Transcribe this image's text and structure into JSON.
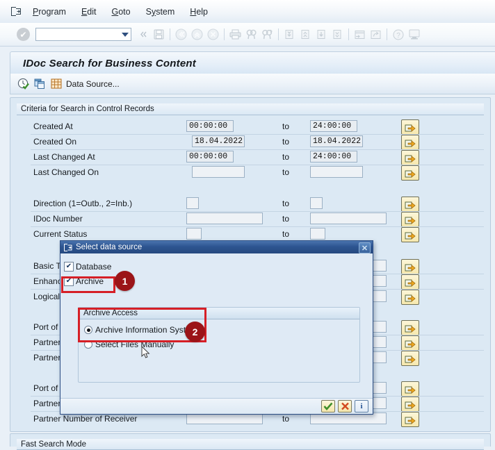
{
  "menu": {
    "sap_icon": "sap-exit-icon",
    "items": [
      {
        "label": "Program",
        "accel": "P"
      },
      {
        "label": "Edit",
        "accel": "E"
      },
      {
        "label": "Goto",
        "accel": "G"
      },
      {
        "label": "System",
        "accel": "y"
      },
      {
        "label": "Help",
        "accel": "H"
      }
    ]
  },
  "toolbar": {
    "enter_icon": "green-check-icon",
    "command_field_value": "",
    "command_field_placeholder": "",
    "icons": [
      "save-icon",
      "back-icon",
      "exit-up-icon",
      "cancel-icon",
      "print-icon",
      "find-icon",
      "find-next-icon",
      "first-page-icon",
      "previous-page-icon",
      "next-page-icon",
      "last-page-icon",
      "create-session-icon",
      "create-shortcut-icon",
      "help-icon",
      "customize-local-layout-icon"
    ]
  },
  "screen": {
    "title": "IDoc Search for Business Content"
  },
  "app_toolbar": {
    "execute_icon": "execute-clock-check-icon",
    "copy_icon": "copy-icon",
    "data_source_icon": "grid-table-icon",
    "data_source_label": "Data Source..."
  },
  "criteria": {
    "group_title": "Criteria for Search in Control Records",
    "to_label": "to",
    "multi_select_icon": "multiple-selection-arrow-icon",
    "rows": [
      {
        "label": "Created At",
        "from": "00:00:00",
        "to": "24:00:00",
        "width": "narrow"
      },
      {
        "label": "Created On",
        "from": "18.04.2022",
        "to": "18.04.2022",
        "width": "narrow"
      },
      {
        "label": "Last Changed At",
        "from": "00:00:00",
        "to": "24:00:00",
        "width": "narrow"
      },
      {
        "label": "Last Changed On",
        "from": "",
        "to": "",
        "width": "narrow"
      }
    ],
    "rows2": [
      {
        "label": "Direction (1=Outb., 2=Inb.)",
        "from": "",
        "to": "",
        "width": "tiny"
      },
      {
        "label": "IDoc Number",
        "from": "",
        "to": "",
        "width": "wide"
      },
      {
        "label": "Current Status",
        "from": "",
        "to": "",
        "width": "tiny"
      }
    ],
    "rows3": [
      {
        "label": "Basic Type",
        "from": "",
        "to": ""
      },
      {
        "label": "Enhancement",
        "from": "",
        "to": ""
      },
      {
        "label": "Logical Message",
        "from": "",
        "to": ""
      }
    ],
    "rows4": [
      {
        "label": "Port of Sender",
        "from": "",
        "to": ""
      },
      {
        "label": "Partner Type of Sender",
        "from": "",
        "to": ""
      },
      {
        "label": "Partner Number of Sender",
        "from": "",
        "to": ""
      }
    ],
    "rows5": [
      {
        "label": "Port of Receiver",
        "from": "",
        "to": ""
      },
      {
        "label": "Partner Type of Receiver",
        "from": "",
        "to": ""
      },
      {
        "label": "Partner Number of Receiver",
        "from": "",
        "to": ""
      }
    ]
  },
  "bottom_group": {
    "title": "Fast Search Mode"
  },
  "dialog": {
    "icon": "dialog-window-icon",
    "title": "Select data source",
    "close_label": "✕",
    "checkboxes": [
      {
        "label": "Database",
        "checked": true,
        "mark": "✔"
      },
      {
        "label": "Archive",
        "checked": true,
        "mark": "✔"
      }
    ],
    "subgroup_title": "Archive Access",
    "radios": [
      {
        "label": "Archive Information System",
        "selected": true
      },
      {
        "label": "Select Files Manually",
        "selected": false
      }
    ],
    "footer": {
      "confirm_icon": "green-check-icon",
      "cancel_icon": "red-x-icon",
      "info_icon": "blue-info-icon",
      "info_label": "i"
    }
  },
  "annotations": {
    "accent_color": "#d61f26",
    "badge_color": "#9b1418",
    "badges": [
      {
        "number": "1",
        "target": "archive-checkbox-group"
      },
      {
        "number": "2",
        "target": "archive-access-radio-group"
      }
    ]
  }
}
